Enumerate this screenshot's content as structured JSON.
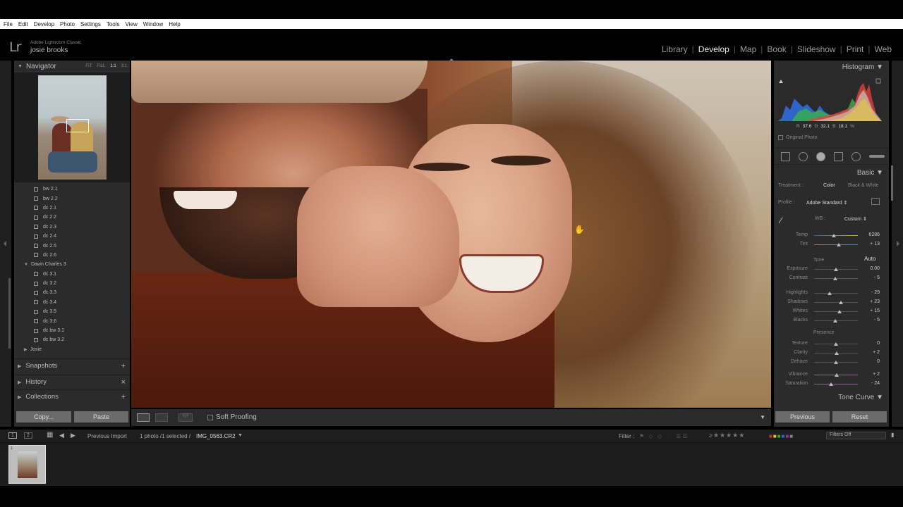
{
  "menubar": [
    "File",
    "Edit",
    "Develop",
    "Photo",
    "Settings",
    "Tools",
    "View",
    "Window",
    "Help"
  ],
  "identity": {
    "logo": "Lr",
    "app_name": "Adobe Lightroom Classic",
    "user": "josie brooks"
  },
  "modules": [
    "Library",
    "Develop",
    "Map",
    "Book",
    "Slideshow",
    "Print",
    "Web"
  ],
  "active_module": "Develop",
  "navigator": {
    "title": "Navigator",
    "options": [
      "FIT",
      "FILL",
      "1:1",
      "3:1"
    ]
  },
  "folders": {
    "items": [
      "bw 2.1",
      "bw 2.2",
      "dc 2.1",
      "dc 2.2",
      "dc 2.3",
      "dc 2.4",
      "dc 2.5",
      "dc 2.6"
    ],
    "group": "Dawn Charles 3",
    "group_items": [
      "dc 3.1",
      "dc 3.2",
      "dc 3.3",
      "dc 3.4",
      "dc 3.5",
      "dc 3.6",
      "dc bw 3.1",
      "dc bw 3.2"
    ],
    "next_group": "Josie"
  },
  "left_sections": {
    "snapshots": "Snapshots",
    "history": "History",
    "collections": "Collections",
    "add": "+",
    "clear": "×"
  },
  "left_buttons": {
    "copy": "Copy...",
    "paste": "Paste"
  },
  "toolbar": {
    "soft_proofing": "Soft Proofing",
    "before_after": "Y|Y"
  },
  "histogram": {
    "title": "Histogram",
    "r_label": "R",
    "r": "37.6",
    "g_label": "G",
    "g": "32.1",
    "b_label": "B",
    "b": "18.1",
    "pct": "%",
    "original": "Original Photo"
  },
  "basic": {
    "title": "Basic",
    "treatment_label": "Treatment :",
    "treatment_color": "Color",
    "treatment_bw": "Black & White",
    "profile_label": "Profile :",
    "profile_value": "Adobe Standard",
    "wb_label": "WB :",
    "wb_value": "Custom",
    "tone_label": "Tone",
    "auto": "Auto",
    "presence_label": "Presence",
    "sliders": [
      {
        "name": "Temp",
        "value": "6286",
        "pos": 0.45
      },
      {
        "name": "Tint",
        "value": "+ 13",
        "pos": 0.56
      },
      {
        "name": "Exposure",
        "value": "0.00",
        "pos": 0.5
      },
      {
        "name": "Contrast",
        "value": "- 5",
        "pos": 0.48
      },
      {
        "name": "Highlights",
        "value": "- 29",
        "pos": 0.36
      },
      {
        "name": "Shadows",
        "value": "+ 23",
        "pos": 0.62
      },
      {
        "name": "Whites",
        "value": "+ 15",
        "pos": 0.58
      },
      {
        "name": "Blacks",
        "value": "- 5",
        "pos": 0.48
      },
      {
        "name": "Texture",
        "value": "0",
        "pos": 0.5
      },
      {
        "name": "Clarity",
        "value": "+ 2",
        "pos": 0.51
      },
      {
        "name": "Dehaze",
        "value": "0",
        "pos": 0.5
      },
      {
        "name": "Vibrance",
        "value": "+ 2",
        "pos": 0.51
      },
      {
        "name": "Saturation",
        "value": "- 24",
        "pos": 0.38
      }
    ]
  },
  "tone_curve": "Tone Curve",
  "right_buttons": {
    "previous": "Previous",
    "reset": "Reset"
  },
  "filmbar": {
    "view1": "1",
    "view2": "2",
    "source": "Previous Import",
    "count": "1 photo /1 selected /",
    "file": "IMG_0563.CR2",
    "filter_label": "Filter :",
    "filters_off": "Filters Off"
  },
  "filmstrip": {
    "thumb_number": "1"
  },
  "colors": {
    "accent_text": "#eeeeee",
    "panel_bg": "#2b2b2b"
  }
}
